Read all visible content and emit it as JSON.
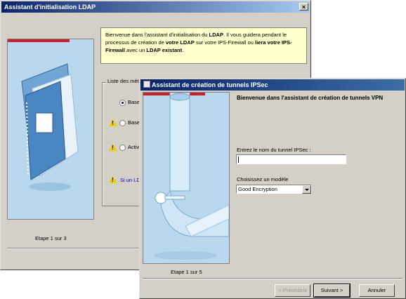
{
  "ldap_wizard": {
    "title": "Assistant d'initialisation LDAP",
    "intro": {
      "t1": "Bienvenue dans l'assistant d'initialisation du ",
      "b1": "LDAP",
      "t2": ". Il vous guidera pendant le processus de création de ",
      "b2": "votre LDAP",
      "t3": " sur votre IPS-Firewall ou ",
      "b3": "liera votre IPS-Firewall",
      "t4": " avec un ",
      "b4": "LDAP existant",
      "t5": "."
    },
    "group_label": "Liste des méthodes d'authentification",
    "options": [
      "Base",
      "Base",
      "Activ"
    ],
    "note": "Si un LD",
    "step": "Etape 1 sur 3"
  },
  "ipsec_wizard": {
    "title": "Assistant de création de tunnels IPSec",
    "heading": "Bienvenue dans l'assistant de création de tunnels VPN",
    "name_label": "Entrez le nom du tunnel IPSec :",
    "name_value": "",
    "model_label": "Choisissez un modèle",
    "model_value": "Good Encryption",
    "step": "Etape 1 sur 5",
    "buttons": {
      "prev": "< Précédent",
      "next": "Suivant >",
      "cancel": "Annuler"
    }
  }
}
